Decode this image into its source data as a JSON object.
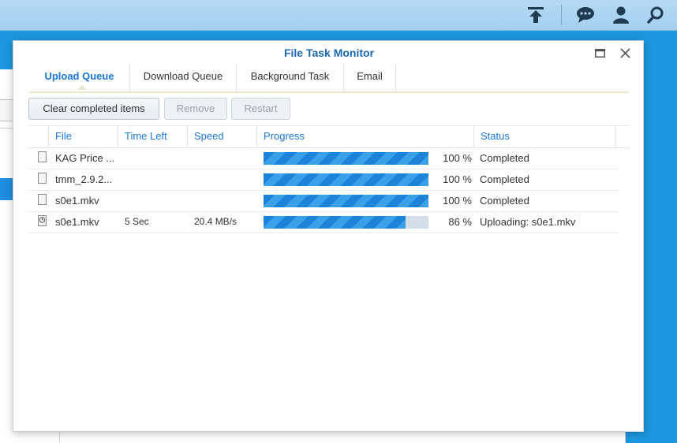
{
  "window": {
    "title": "File Task Monitor",
    "accent_color": "#1b77d3"
  },
  "topbar_icons": [
    "upload-icon",
    "chat-icon",
    "user-icon",
    "search-icon"
  ],
  "tabs": [
    {
      "label": "Upload Queue",
      "active": true
    },
    {
      "label": "Download Queue",
      "active": false
    },
    {
      "label": "Background Task",
      "active": false
    },
    {
      "label": "Email",
      "active": false
    }
  ],
  "toolbar": {
    "clear_label": "Clear completed items",
    "remove_label": "Remove",
    "restart_label": "Restart"
  },
  "columns": {
    "file": "File",
    "time_left": "Time Left",
    "speed": "Speed",
    "progress": "Progress",
    "status": "Status"
  },
  "rows": [
    {
      "icon": "file-icon",
      "file": "KAG Price ...",
      "time_left": "",
      "speed": "",
      "progress": 1.0,
      "percent": "100 %",
      "status": "Completed"
    },
    {
      "icon": "file-icon",
      "file": "tmm_2.9.2...",
      "time_left": "",
      "speed": "",
      "progress": 1.0,
      "percent": "100 %",
      "status": "Completed"
    },
    {
      "icon": "file-icon",
      "file": "s0e1.mkv",
      "time_left": "",
      "speed": "",
      "progress": 1.0,
      "percent": "100 %",
      "status": "Completed"
    },
    {
      "icon": "clock-file-icon",
      "file": "s0e1.mkv",
      "time_left": "5 Sec",
      "speed": "20.4 MB/s",
      "progress": 0.86,
      "percent": "86 %",
      "status": "Uploading: s0e1.mkv"
    }
  ]
}
